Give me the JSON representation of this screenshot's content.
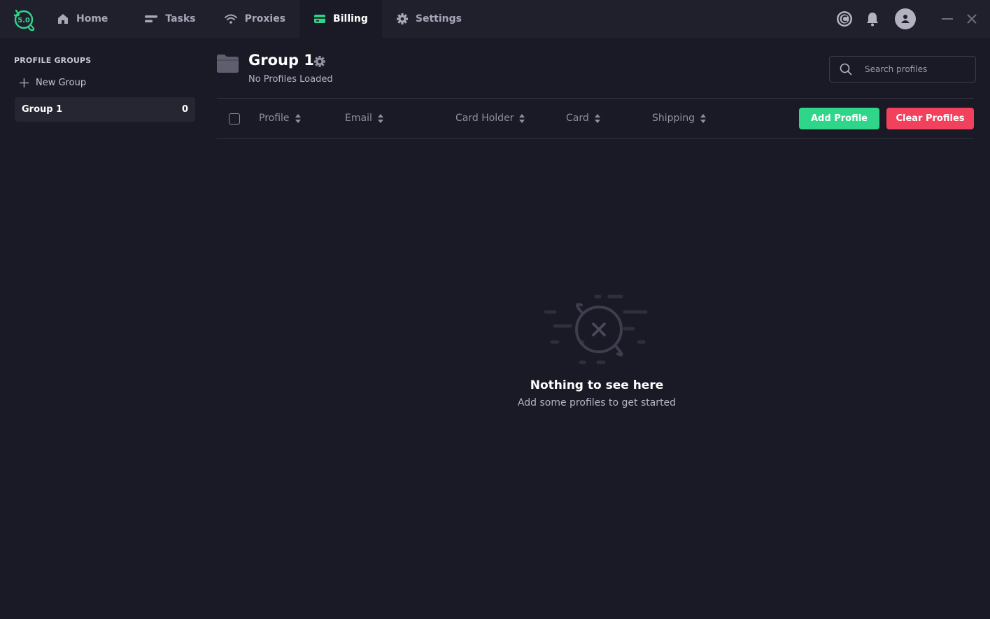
{
  "app": {
    "logo_text": "5.0",
    "accent_color": "#2fd68a",
    "danger_color": "#f2415c"
  },
  "nav": {
    "items": [
      {
        "label": "Home",
        "icon": "home-icon"
      },
      {
        "label": "Tasks",
        "icon": "tasks-icon"
      },
      {
        "label": "Proxies",
        "icon": "wifi-icon"
      },
      {
        "label": "Billing",
        "icon": "card-icon",
        "active": true
      },
      {
        "label": "Settings",
        "icon": "gear-icon"
      }
    ]
  },
  "sidebar": {
    "title": "PROFILE GROUPS",
    "new_group_label": "New Group",
    "groups": [
      {
        "name": "Group 1",
        "count": "0"
      }
    ]
  },
  "header": {
    "title": "Group 1",
    "subtitle": "No Profiles Loaded",
    "search_placeholder": "Search profiles"
  },
  "table": {
    "columns": [
      "Profile",
      "Email",
      "Card Holder",
      "Card",
      "Shipping"
    ]
  },
  "actions": {
    "add_label": "Add Profile",
    "clear_label": "Clear Profiles"
  },
  "empty_state": {
    "title": "Nothing to see here",
    "subtitle": "Add some profiles to get started"
  }
}
